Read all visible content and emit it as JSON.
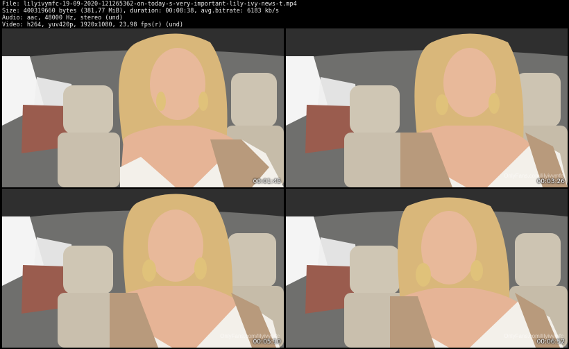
{
  "file_info": {
    "file_line": "File: lilyivymfc-19-09-2020-121265362-on-today-s-very-important-lily-ivy-news-t.mp4",
    "size_line": "Size: 400319660 bytes (381,77 MiB), duration: 00:08:38, avg.bitrate: 6183 kb/s",
    "audio_line": "Audio: aac, 48000 Hz, stereo (und)",
    "video_line": "Video: h264, yuv420p, 1920x1080, 23,98 fps(r) (und)"
  },
  "thumbnails": [
    {
      "timestamp": "00:01:45",
      "watermark": ""
    },
    {
      "timestamp": "00:03:26",
      "watermark": "OnlyFans.com/lilyivymfc"
    },
    {
      "timestamp": "00:05:10",
      "watermark": "OnlyFans.com/lilyivymfc"
    },
    {
      "timestamp": "00:06:52",
      "watermark": "OnlyFans.com/lilyivymfc"
    }
  ],
  "colors": {
    "background": "#000000",
    "header_text": "#e8e8e8",
    "car_interior": "#8a8a88",
    "seat": "#cfc6b4",
    "window": "#f2f2f2",
    "hair": "#d9b77a",
    "skin": "#e8b99a",
    "sweater_white": "#f3f0ea",
    "sweater_tan": "#b89a7c"
  }
}
